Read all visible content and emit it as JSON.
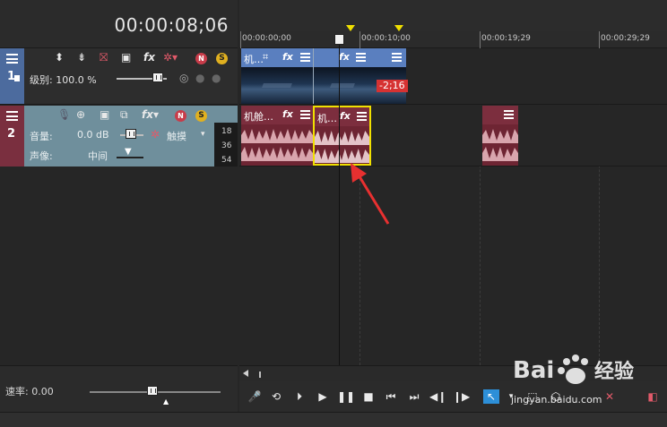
{
  "header": {
    "timecode": "00:00:08;06"
  },
  "ruler": {
    "labels": [
      "00:00:00;00",
      "00:00:10;00",
      "00:00:19;29",
      "00:00:29;29"
    ]
  },
  "track1": {
    "number": "1",
    "level_label": "级别: 100.0 %",
    "clips": [
      {
        "title": "机…"
      },
      {
        "title": ""
      },
      {
        "title": ""
      }
    ],
    "duration_badge": "-2;16"
  },
  "track2": {
    "number": "2",
    "volume_label": "音量:",
    "volume_value": "0.0 dB",
    "pan_label": "声像:",
    "pan_value": "中间",
    "touch_label": "触摸",
    "meter_ticks": [
      "18",
      "36",
      "54"
    ],
    "clips": [
      {
        "title": "机舱…"
      },
      {
        "title": "机…"
      },
      {
        "title": ""
      }
    ]
  },
  "bottom": {
    "rate_label": "速率: 0.00"
  },
  "watermark": {
    "brand": "Bai 经验",
    "url": "jingyan.baidu.com"
  },
  "colors": {
    "video_track": "#4c6b9e",
    "audio_track": "#7a2f3f",
    "selected_clip_border": "#f0e000",
    "annotation_arrow": "#e83030"
  },
  "icons": [
    "menu-icon",
    "fx-icon",
    "mute-icon",
    "solo-icon",
    "playhead-icon",
    "record-icon",
    "loop-icon",
    "play-icon",
    "pause-icon",
    "stop-icon"
  ]
}
